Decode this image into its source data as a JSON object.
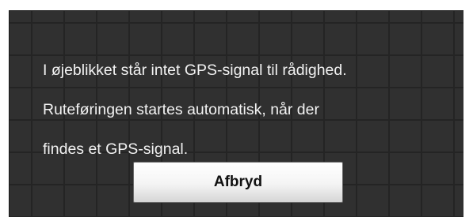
{
  "dialog": {
    "message_lines": [
      "I øjeblikket står intet GPS-signal til rådighed.",
      "Ruteføringen startes automatisk, når der",
      "findes et GPS-signal."
    ],
    "cancel_label": "Afbryd"
  },
  "colors": {
    "background": "#303030",
    "grid_line": "#242424",
    "text": "#f2f2f2",
    "button_top": "#ffffff",
    "button_bottom": "#d6d6d6"
  }
}
